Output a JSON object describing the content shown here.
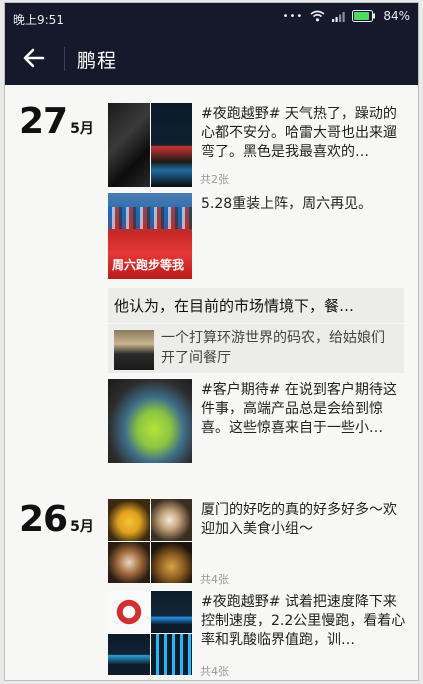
{
  "status": {
    "time": "晚上9:51",
    "battery": "84%"
  },
  "nav": {
    "title": "鹏程"
  },
  "days": [
    {
      "num": "27",
      "month": "5月"
    },
    {
      "num": "26",
      "month": "5月"
    }
  ],
  "posts": [
    {
      "text": "#夜跑越野# 天气热了，躁动的心都不安分。哈雷大哥也出来遛弯了。黑色是我最喜欢的…",
      "count": "共2张"
    },
    {
      "text": "5.28重装上阵，周六再见。",
      "thumb_caption": "周六跑步等我"
    },
    {
      "comment": "他认为，在目前的市场情境下，餐…",
      "shared_text": "一个打算环游世界的码农，给姑娘们开了间餐厅"
    },
    {
      "text": "#客户期待# 在说到客户期待这件事，高端产品总是会给到惊喜。这些惊喜来自于一些小…"
    },
    {
      "text": "厦门的好吃的真的好多好多～欢迎加入美食小组～",
      "count": "共4张"
    },
    {
      "text": "#夜跑越野# 试着把速度降下来控制速度，2.2公里慢跑，看着心率和乳酸临界值跑，训…",
      "count": "共4张"
    }
  ]
}
